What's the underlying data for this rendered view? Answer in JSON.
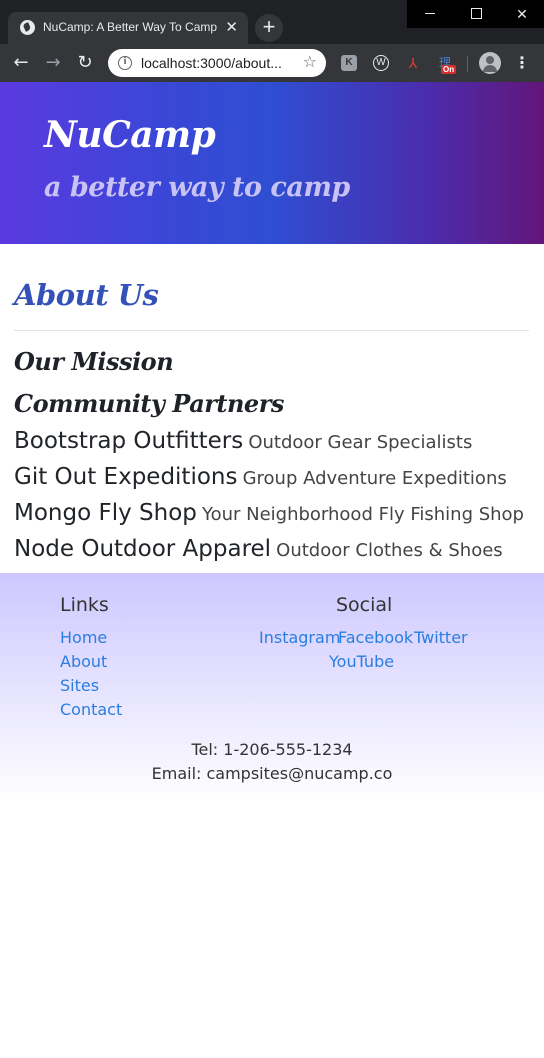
{
  "browser": {
    "tab_title": "NuCamp: A Better Way To Camp",
    "tab_close": "✕",
    "new_tab": "+",
    "url": "localhost:3000/about...",
    "ext_badge": "On"
  },
  "jumbotron": {
    "brand": "NuCamp",
    "tagline": "a better way to camp"
  },
  "main": {
    "title": "About Us",
    "mission_heading": "Our Mission",
    "partners_heading": "Community Partners",
    "partners": [
      {
        "name": "Bootstrap Outfitters",
        "description": "Outdoor Gear Specialists"
      },
      {
        "name": "Git Out Expeditions",
        "description": "Group Adventure Expeditions"
      },
      {
        "name": "Mongo Fly Shop",
        "description": "Your Neighborhood Fly Fishing Shop"
      },
      {
        "name": "Node Outdoor Apparel",
        "description": "Outdoor Clothes & Shoes"
      }
    ]
  },
  "footer": {
    "links_heading": "Links",
    "links": [
      "Home",
      "About",
      "Sites",
      "Contact"
    ],
    "social_heading": "Social",
    "social": [
      "Instagram",
      "Facebook",
      "Twitter",
      "YouTube"
    ],
    "tel": "Tel: 1-206-555-1234",
    "email": "Email: campsites@nucamp.co"
  },
  "colors": {
    "accent": "#3451b9",
    "link": "#2a7ee0"
  }
}
